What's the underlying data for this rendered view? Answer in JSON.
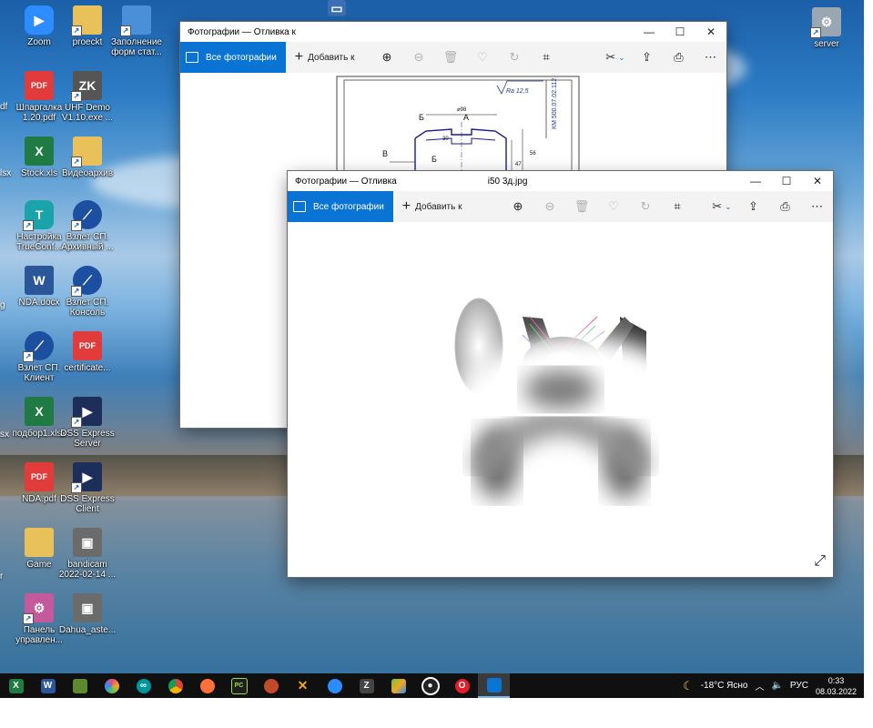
{
  "desktop_icons": [
    {
      "label": "Zoom",
      "color": "#2d8cff",
      "glyph": "Z"
    },
    {
      "label": "proeckt",
      "color": "#e8c15a",
      "glyph": ""
    },
    {
      "label": "Заполнение форм стат...",
      "color": "#4a90d9",
      "glyph": ""
    },
    {
      "label": "Шпаргалка 1.20.pdf",
      "color": "#e23b3b",
      "glyph": "PDF"
    },
    {
      "label": "UHF Demo V1.10.exe ...",
      "color": "#555555",
      "glyph": "ZK"
    },
    {
      "label": "Stock.xls",
      "color": "#1f7a43",
      "glyph": "X"
    },
    {
      "label": "Видеоархив",
      "color": "#e8c15a",
      "glyph": ""
    },
    {
      "label": "Настройка TrueConf...",
      "color": "#1aa3a8",
      "glyph": "T"
    },
    {
      "label": "Взлет СП. Архивный ...",
      "color": "#1c4fa0",
      "glyph": ""
    },
    {
      "label": "NDA.docx",
      "color": "#2b579a",
      "glyph": "W"
    },
    {
      "label": "Взлет СП. Консоль",
      "color": "#1c4fa0",
      "glyph": ""
    },
    {
      "label": "Взлет СП. Клиент",
      "color": "#1c4fa0",
      "glyph": ""
    },
    {
      "label": "certificate...",
      "color": "#e23b3b",
      "glyph": "PDF"
    },
    {
      "label": "подбор1.xlsx",
      "color": "#1f7a43",
      "glyph": "X"
    },
    {
      "label": "DSS Express Server",
      "color": "#1d2e5a",
      "glyph": ""
    },
    {
      "label": "NDA.pdf",
      "color": "#e23b3b",
      "glyph": "PDF"
    },
    {
      "label": "DSS Express Client",
      "color": "#1d2e5a",
      "glyph": ""
    },
    {
      "label": "Game",
      "color": "#e8c15a",
      "glyph": ""
    },
    {
      "label": "bandicam 2022-02-14 ...",
      "color": "#6b6b6b",
      "glyph": ""
    },
    {
      "label": "Панель управлен...",
      "color": "#c45a9c",
      "glyph": ""
    },
    {
      "label": "Dahua_aste...",
      "color": "#6b6b6b",
      "glyph": ""
    },
    {
      "label": "server",
      "color": "#9aa6b2",
      "glyph": ""
    }
  ],
  "edge_labels": [
    "df",
    "lsx",
    "g",
    "",
    "sx",
    "",
    "r"
  ],
  "photos_back": {
    "title": "Фотографии — Отливка к",
    "all_photos": "Все фотографии",
    "add_to": "Добавить к"
  },
  "photos_front": {
    "title": "Фотографии — Отливка",
    "title_suffix": "i50 3д.jpg",
    "all_photos": "Все фотографии",
    "add_to": "Добавить к"
  },
  "drawing": {
    "stamp": "КМ 500.07.02.112",
    "roughness": "Ra 12,5",
    "letters": [
      "Б",
      "А",
      "В",
      "Б"
    ],
    "dims": [
      "⌀98",
      "56",
      "30",
      "47"
    ]
  },
  "window_controls": {
    "minimize": "—",
    "maximize": "☐",
    "close": "✕"
  },
  "taskbar": {
    "apps": [
      {
        "name": "excel-app-icon",
        "color": "#1f7a43",
        "glyph": "X"
      },
      {
        "name": "word-app-icon",
        "color": "#2b579a",
        "glyph": "W"
      },
      {
        "name": "minecraft-app-icon",
        "color": "#5d8a2f",
        "glyph": ""
      },
      {
        "name": "pinwheel-app-icon",
        "color": "#e8507a",
        "glyph": ""
      },
      {
        "name": "arduino-app-icon",
        "color": "#00979c",
        "glyph": "∞"
      },
      {
        "name": "chrome-app-icon",
        "color": "#db4437",
        "glyph": ""
      },
      {
        "name": "firefox-app-icon",
        "color": "#ff7139",
        "glyph": ""
      },
      {
        "name": "pycharm-app-icon",
        "color": "#1e1e1e",
        "glyph": "PC"
      },
      {
        "name": "bandicam-app-icon",
        "color": "#c24a2b",
        "glyph": ""
      },
      {
        "name": "drone-app-icon",
        "color": "#f2a81d",
        "glyph": "✕"
      },
      {
        "name": "zoom-app-icon",
        "color": "#2d8cff",
        "glyph": ""
      },
      {
        "name": "zk-app-icon",
        "color": "#444444",
        "glyph": "Z"
      },
      {
        "name": "bluestacks-app-icon",
        "color": "#6cc04a",
        "glyph": ""
      },
      {
        "name": "obs-app-icon",
        "color": "#222222",
        "glyph": "●"
      },
      {
        "name": "opera-app-icon",
        "color": "#e51d2a",
        "glyph": "O"
      },
      {
        "name": "photos-app-icon",
        "color": "#0a74d4",
        "glyph": ""
      }
    ],
    "weather": "-18°C Ясно",
    "language": "РУС",
    "time": "0:33",
    "date": "08.03.2022"
  }
}
